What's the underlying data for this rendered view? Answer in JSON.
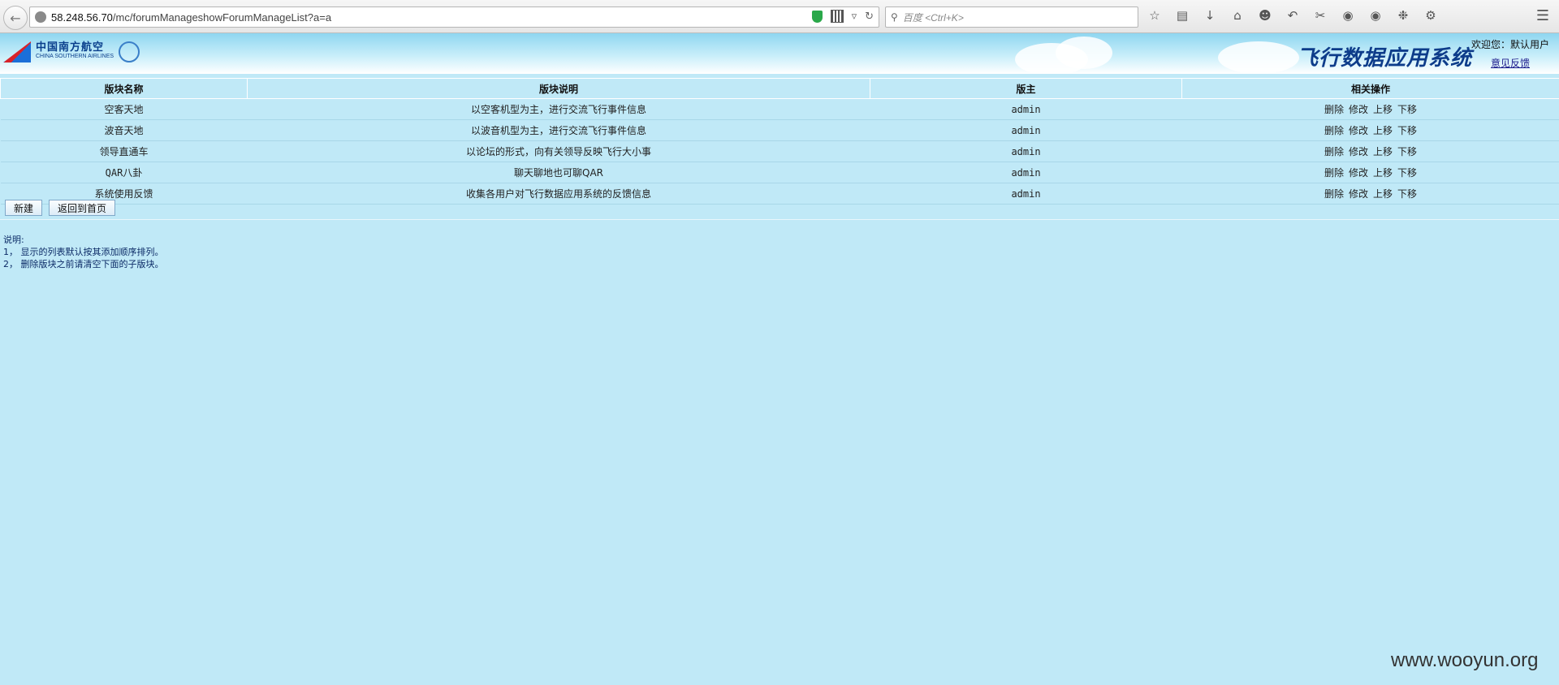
{
  "browser": {
    "url_host": "58.248.56.70",
    "url_path": "/mc/forumManageshowForumManageList?a=a",
    "search_placeholder": "百度 <Ctrl+K>"
  },
  "header": {
    "logo_cn": "中国南方航空",
    "logo_en": "CHINA SOUTHERN AIRLINES",
    "system_title": "飞行数据应用系统",
    "welcome": "欢迎您：默认用户",
    "feedback": "意见反馈"
  },
  "table": {
    "columns": [
      "版块名称",
      "版块说明",
      "版主",
      "相关操作"
    ],
    "rows": [
      {
        "name": "空客天地",
        "desc": "以空客机型为主，进行交流飞行事件信息",
        "owner": "admin"
      },
      {
        "name": "波音天地",
        "desc": "以波音机型为主，进行交流飞行事件信息",
        "owner": "admin"
      },
      {
        "name": "领导直通车",
        "desc": "以论坛的形式，向有关领导反映飞行大小事",
        "owner": "admin"
      },
      {
        "name": "QAR八卦",
        "desc": "聊天聊地也可聊QAR",
        "owner": "admin"
      },
      {
        "name": "系统使用反馈",
        "desc": "收集各用户对飞行数据应用系统的反馈信息",
        "owner": "admin"
      }
    ],
    "ops": {
      "delete": "删除",
      "edit": "修改",
      "up": "上移",
      "down": "下移"
    }
  },
  "buttons": {
    "new": "新建",
    "home": "返回到首页"
  },
  "notes": {
    "title": "说明:",
    "line1": "1， 显示的列表默认按其添加顺序排列。",
    "line2": "2， 删除版块之前请清空下面的子版块。"
  },
  "watermark": "www.wooyun.org"
}
